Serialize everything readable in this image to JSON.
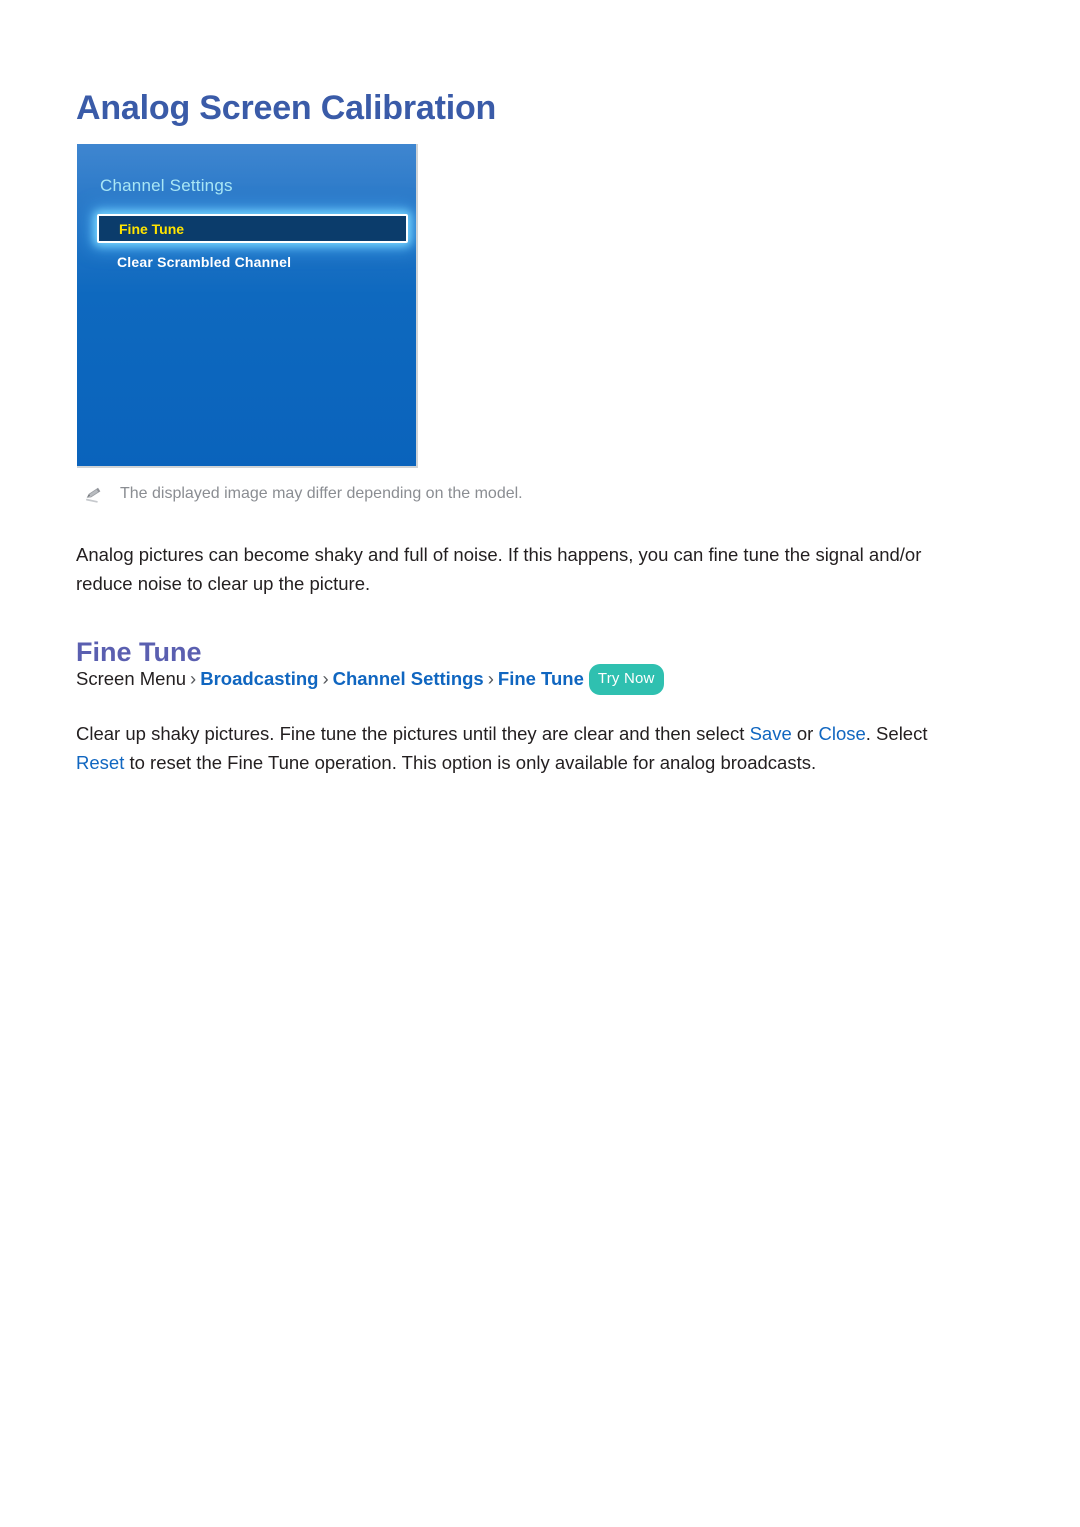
{
  "page": {
    "title": "Analog Screen Calibration"
  },
  "tv_panel": {
    "title": "Channel Settings",
    "items": [
      {
        "label": "Fine Tune",
        "selected": true
      },
      {
        "label": "Clear Scrambled Channel",
        "selected": false
      }
    ]
  },
  "note": {
    "icon": "pencil-icon",
    "text": "The displayed image may differ depending on the model."
  },
  "intro_paragraph": "Analog pictures can become shaky and full of noise. If this happens, you can fine tune the signal and/or reduce noise to clear up the picture.",
  "section": {
    "heading": "Fine Tune",
    "breadcrumb": {
      "root": "Screen Menu",
      "separator": "›",
      "links": [
        "Broadcasting",
        "Channel Settings",
        "Fine Tune"
      ],
      "badge": "Try Now"
    },
    "description": {
      "part1": "Clear up shaky pictures. Fine tune the pictures until they are clear and then select ",
      "kw1": "Save",
      "part2": " or ",
      "kw2": "Close",
      "part3": ". Select ",
      "kw3": "Reset",
      "part4": " to reset the Fine Tune operation. This option is only available for analog broadcasts."
    }
  },
  "colors": {
    "title_blue": "#3a5ba8",
    "heading_purple": "#5a5fb0",
    "link_blue": "#1066c0",
    "badge_teal": "#2fc0b0",
    "panel_blue_top": "#3f86d0",
    "panel_blue_bottom": "#0a63bc",
    "selected_navy": "#0b3c6b",
    "selected_yellow": "#ffe400",
    "panel_title_cyan": "#a8e6f5",
    "note_gray": "#8a8d92"
  }
}
